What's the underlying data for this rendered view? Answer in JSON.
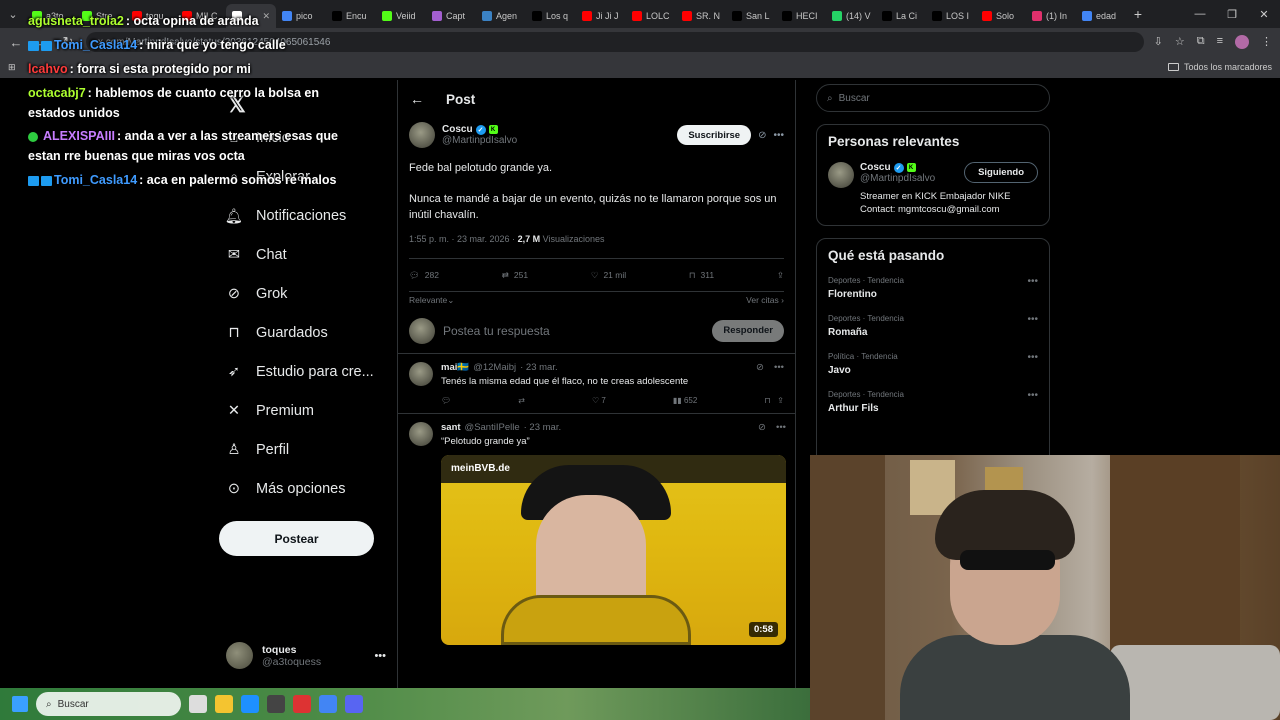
{
  "browser": {
    "tabs": [
      {
        "label": "a3to",
        "color": "#53fc18"
      },
      {
        "label": "Stre",
        "color": "#53fc18"
      },
      {
        "label": "toqu",
        "color": "#ff0000"
      },
      {
        "label": "MILC",
        "color": "#ff0000"
      },
      {
        "label": "",
        "color": "#ffffff",
        "active": true
      },
      {
        "label": "pico",
        "color": "#4285f4"
      },
      {
        "label": "Encu",
        "color": "#000000"
      },
      {
        "label": "Veiid",
        "color": "#53fc18"
      },
      {
        "label": "Capt",
        "color": "#a35fd0"
      },
      {
        "label": "Agen",
        "color": "#3b82c4"
      },
      {
        "label": "Los q",
        "color": "#000000"
      },
      {
        "label": "Ji Ji J",
        "color": "#ff0000"
      },
      {
        "label": "LOLC",
        "color": "#ff0000"
      },
      {
        "label": "SR. N",
        "color": "#ff0000"
      },
      {
        "label": "San L",
        "color": "#000000"
      },
      {
        "label": "HECI",
        "color": "#000000"
      },
      {
        "label": "(14) V",
        "color": "#25d366"
      },
      {
        "label": "La Ci",
        "color": "#000000"
      },
      {
        "label": "LOS I",
        "color": "#000000"
      },
      {
        "label": "Solo",
        "color": "#ff0000"
      },
      {
        "label": "(1) In",
        "color": "#e1306c"
      },
      {
        "label": "edad",
        "color": "#4285f4"
      }
    ],
    "url": "x.com/MartinpdIsalvo/status/2036124504065061546",
    "bookmarks_label": "Todos los marcadores"
  },
  "nav": {
    "items": [
      {
        "label": "Inicio",
        "icon": "home-icon"
      },
      {
        "label": "Explorar",
        "icon": "search-icon"
      },
      {
        "label": "Notificaciones",
        "icon": "bell-icon"
      },
      {
        "label": "Chat",
        "icon": "mail-icon"
      },
      {
        "label": "Grok",
        "icon": "grok-icon"
      },
      {
        "label": "Guardados",
        "icon": "bookmark-icon"
      },
      {
        "label": "Estudio para cre...",
        "icon": "rocket-icon"
      },
      {
        "label": "Premium",
        "icon": "x-icon"
      },
      {
        "label": "Perfil",
        "icon": "person-icon"
      },
      {
        "label": "Más opciones",
        "icon": "more-icon"
      }
    ],
    "post_button": "Postear",
    "account": {
      "name": "toques",
      "handle": "@a3toquess"
    }
  },
  "post": {
    "header_title": "Post",
    "author": {
      "name": "Coscu",
      "handle": "@MartinpdIsalvo"
    },
    "subscribe_label": "Suscribirse",
    "text_1": "Fede bal pelotudo grande ya.",
    "text_2": "Nunca te mandé a bajar de un evento, quizás no te llamaron porque sos un inútil chavalín.",
    "timestamp": "1:55 p. m. · 23 mar. 2026 ·",
    "views": "2,7 M",
    "views_label": "Visualizaciones",
    "stats": {
      "replies": "282",
      "reposts": "251",
      "likes": "21 mil",
      "bookmarks": "311"
    },
    "sort_label": "Relevante",
    "quotes_label": "Ver citas",
    "reply_placeholder": "Postea tu respuesta",
    "reply_button": "Responder"
  },
  "replies": [
    {
      "name": "mai🇸🇪",
      "handle": "@12Maibj",
      "date": "· 23 mar.",
      "text": "Tenés la misma edad que él flaco, no te creas adolescente",
      "likes": "7",
      "views": "652"
    },
    {
      "name": "sant",
      "handle": "@SantiIPelle",
      "date": "· 23 mar.",
      "text": "“Pelotudo grande ya”",
      "video_watermark": "meinBVB.de",
      "video_duration": "0:58"
    }
  ],
  "sidebar": {
    "search_placeholder": "Buscar",
    "relevant_title": "Personas relevantes",
    "relevant_person": {
      "name": "Coscu",
      "handle": "@MartinpdIsalvo",
      "follow_label": "Siguiendo",
      "bio_1": "Streamer en KICK Embajador NIKE",
      "bio_2": "Contact: mgmtcoscu@gmail.com"
    },
    "trending_title": "Qué está pasando",
    "trends": [
      {
        "category": "Deportes · Tendencia",
        "title": "Florentino"
      },
      {
        "category": "Deportes · Tendencia",
        "title": "Romaña"
      },
      {
        "category": "Política · Tendencia",
        "title": "Javo"
      },
      {
        "category": "Deportes · Tendencia",
        "title": "Arthur Fils"
      }
    ]
  },
  "chat": [
    {
      "user": "agusneta_trola2",
      "text": ": octa opina de aranda",
      "color": "#adff2f"
    },
    {
      "user": "Tomi_Casla14",
      "text": ": mira que yo tengo calle",
      "color": "#3f9bff",
      "badge": true
    },
    {
      "user": "lcahvo",
      "text": ": forra si esta protegido por mi",
      "color": "#ff3b3b"
    },
    {
      "user": "octacabj7",
      "text": ": hablemos de cuanto cerro la bolsa en",
      "color": "#adff2f"
    },
    {
      "user": "",
      "text": "estados unidos",
      "color": "#ffffff"
    },
    {
      "user": "ALEXISPAIII",
      "text": ": anda a ver a las streamers esas que",
      "color": "#c77dff",
      "badge_g": true
    },
    {
      "user": "",
      "text": "estan rre buenas que miras vos octa",
      "color": "#ffffff"
    },
    {
      "user": "Tomi_Casla14",
      "text": ": aca en palermo somos re malos",
      "color": "#3f9bff",
      "badge": true
    }
  ],
  "taskbar": {
    "search_placeholder": "Buscar"
  }
}
